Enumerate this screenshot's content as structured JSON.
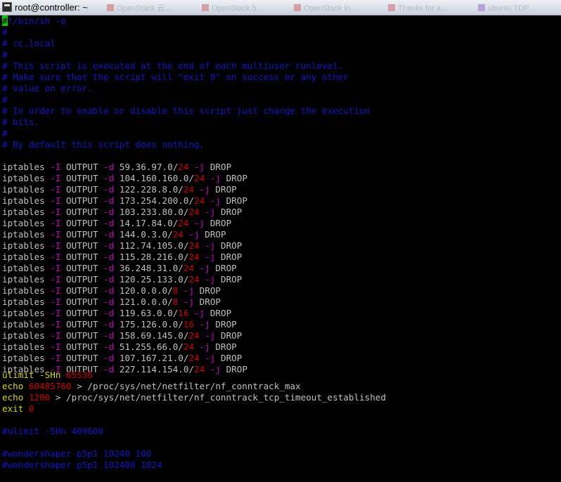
{
  "window": {
    "title": "root@controller: ~"
  },
  "background_tabs": [
    "OpenStack 云...",
    "OpenStack 5...",
    "OpenStack In...",
    "Thanks for a...",
    "ubuntu TDP..."
  ],
  "colors": {
    "comment": "#1515c8",
    "number": "#cd0000",
    "flag": "#c000c0",
    "keyword": "#d7d700",
    "cursor": "#00cd00",
    "text": "#c0c0c0"
  },
  "header": {
    "cursor_char": "#",
    "shebang_rest": "!/bin/sh -e",
    "comments": [
      "#",
      "# rc.local",
      "#",
      "# This script is executed at the end of each multiuser runlevel.",
      "# Make sure that the script will \"exit 0\" on success or any other",
      "# value on error.",
      "#",
      "# In order to enable or disable this script just change the execution",
      "# bits.",
      "#",
      "# By default this script does nothing."
    ]
  },
  "iptables": {
    "cmd": "iptables",
    "flag_insert": "-I",
    "chain": "OUTPUT",
    "flag_dest": "-d",
    "flag_jump": "-j",
    "target": "DROP",
    "rules": [
      {
        "ip": "59.36.97.0/",
        "mask": "24"
      },
      {
        "ip": "104.160.160.0/",
        "mask": "24"
      },
      {
        "ip": "122.228.8.0/",
        "mask": "24"
      },
      {
        "ip": "173.254.200.0/",
        "mask": "24"
      },
      {
        "ip": "103.233.80.0/",
        "mask": "24"
      },
      {
        "ip": "14.17.84.0/",
        "mask": "24"
      },
      {
        "ip": "144.0.3.0/",
        "mask": "24"
      },
      {
        "ip": "112.74.105.0/",
        "mask": "24"
      },
      {
        "ip": "115.28.216.0/",
        "mask": "24"
      },
      {
        "ip": "36.248.31.0/",
        "mask": "24"
      },
      {
        "ip": "120.25.133.0/",
        "mask": "24"
      },
      {
        "ip": "120.0.0.0/",
        "mask": "8"
      },
      {
        "ip": "121.0.0.0/",
        "mask": "8"
      },
      {
        "ip": "119.63.0.0/",
        "mask": "16"
      },
      {
        "ip": "175.126.0.0/",
        "mask": "16"
      },
      {
        "ip": "158.69.145.0/",
        "mask": "24"
      },
      {
        "ip": "51.255.66.0/",
        "mask": "24"
      },
      {
        "ip": "107.167.21.0/",
        "mask": "24"
      },
      {
        "ip": "227.114.154.0/",
        "mask": "24"
      }
    ]
  },
  "tail": {
    "ulimit": {
      "kw": "ulimit",
      "flag": "-SHn",
      "value": "65536"
    },
    "echo1": {
      "kw": "echo",
      "value": "60485760",
      "rest": " > /proc/sys/net/netfilter/nf_conntrack_max"
    },
    "echo2": {
      "kw": "echo",
      "value": "1200",
      "rest": " > /proc/sys/net/netfilter/nf_conntrack_tcp_timeout_established"
    },
    "exit": {
      "kw": "exit",
      "value": "0"
    },
    "commented": [
      "#ulimit -SHn 409600",
      "#wondershaper p5p1 10240 100",
      "#wondershaper p5p1 102400 1024"
    ]
  }
}
